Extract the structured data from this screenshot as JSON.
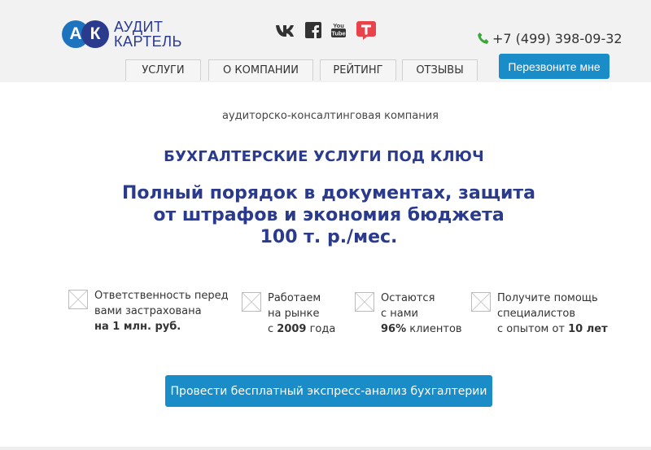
{
  "brand": {
    "logo_letters": [
      "А",
      "К"
    ],
    "name_line1": "АУДИТ",
    "name_line2": "КАРТЕЛЬ",
    "colors": {
      "blue": "#1e73be",
      "navy": "#2a3a8c",
      "button": "#1a8cc8",
      "phone_green": "#3aa83a"
    }
  },
  "social": [
    {
      "icon": "vk-icon",
      "label": "VK"
    },
    {
      "icon": "facebook-icon",
      "label": "Facebook"
    },
    {
      "icon": "youtube-icon",
      "label": "YouTube"
    },
    {
      "icon": "tenchat-icon",
      "label": "T"
    }
  ],
  "contact": {
    "phone": "+7 (499) 398-09-32",
    "callback_label": "Перезвоните мне"
  },
  "nav": {
    "items": [
      "УСЛУГИ",
      "О КОМПАНИИ",
      "РЕЙТИНГ",
      "ОТЗЫВЫ"
    ]
  },
  "hero": {
    "subtitle": "аудиторско-консалтинговая компания",
    "heading": "БУХГАЛТЕРСКИЕ УСЛУГИ ПОД КЛЮЧ",
    "title_line1": "Полный порядок в документах, защита",
    "title_line2": "от штрафов и экономия бюджета",
    "title_line3": "100 т. р./мес."
  },
  "features": [
    {
      "line1": "Ответственность перед",
      "line2": "вами застрахована",
      "line3_strong": "на 1 млн. руб.",
      "line3_rest": ""
    },
    {
      "line1": "Работаем",
      "line2": "на рынке",
      "line3_pre": "с ",
      "line3_strong": "2009",
      "line3_rest": " года"
    },
    {
      "line1": "Остаются",
      "line2": "с нами",
      "line3_strong": "96%",
      "line3_rest": " клиентов"
    },
    {
      "line1": "Получите помощь",
      "line2": "специалистов",
      "line3_pre": "с опытом от ",
      "line3_strong": "10 лет",
      "line3_rest": ""
    }
  ],
  "cta": {
    "label": "Провести бесплатный экспресс-анализ бухгалтерии"
  }
}
